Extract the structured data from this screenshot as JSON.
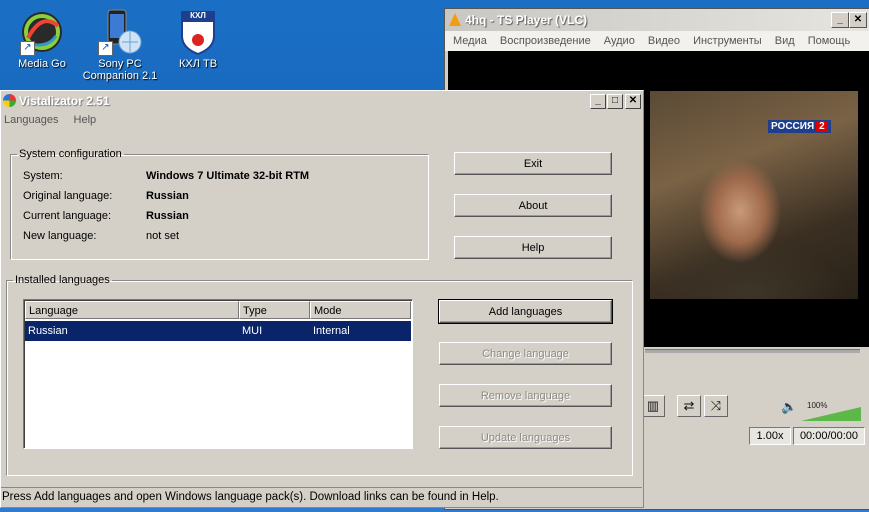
{
  "desktop": {
    "icons": [
      {
        "label": "Media Go"
      },
      {
        "label_line1": "Sony PC",
        "label_line2": "Companion 2.1"
      },
      {
        "label": "КХЛ ТВ",
        "logo_text": "КХЛ"
      }
    ]
  },
  "vlc": {
    "title": "4hq - TS Player (VLC)",
    "menu": [
      "Медиа",
      "Воспроизведение",
      "Аудио",
      "Видео",
      "Инструменты",
      "Вид",
      "Помощь"
    ],
    "channel_logo": "РОССИЯ",
    "channel_number": "2",
    "volume": "100%",
    "volume_level": 1.0,
    "rate": "1.00x",
    "time": "00:00/00:00",
    "title_buttons": {
      "minimize": "_",
      "close": "✕"
    }
  },
  "vistalizator": {
    "title": "Vistalizator 2.51",
    "title_buttons": {
      "minimize": "_",
      "maximize": "□",
      "close": "✕"
    },
    "menu": [
      "Languages",
      "Help"
    ],
    "system_configuration": {
      "legend": "System configuration",
      "rows": [
        {
          "label": "System:",
          "value": "Windows 7 Ultimate 32-bit RTM"
        },
        {
          "label": "Original language:",
          "value": "Russian"
        },
        {
          "label": "Current language:",
          "value": "Russian"
        },
        {
          "label": "New language:",
          "value": "not set"
        }
      ]
    },
    "buttons": {
      "exit": "Exit",
      "about": "About",
      "help": "Help",
      "add_languages": "Add languages",
      "change_language": "Change language",
      "remove_language": "Remove language",
      "update_languages": "Update languages"
    },
    "installed_languages": {
      "legend": "Installed languages",
      "columns": [
        "Language",
        "Type",
        "Mode"
      ],
      "rows": [
        {
          "language": "Russian",
          "type": "MUI",
          "mode": "Internal"
        }
      ]
    },
    "status": "Press Add languages and open Windows language pack(s). Download links can be found in Help."
  },
  "colors": {
    "desktop_bg": "#1560b6",
    "selection": "#0a246a",
    "window_face": "#d4d0c8"
  }
}
